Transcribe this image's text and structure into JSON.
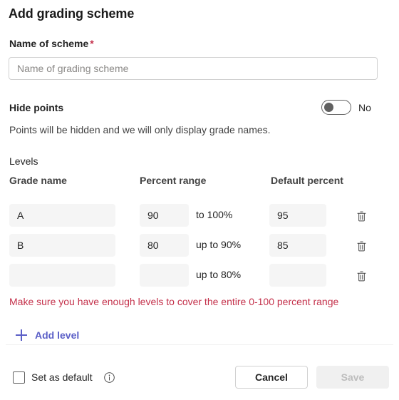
{
  "page_title": "Add grading scheme",
  "name_field": {
    "label": "Name of scheme",
    "required_marker": "*",
    "value": "",
    "placeholder": "Name of grading scheme"
  },
  "hide_points": {
    "label": "Hide points",
    "state": "No",
    "description": "Points will be hidden and we will only display grade names."
  },
  "levels": {
    "section_label": "Levels",
    "columns": {
      "grade_name": "Grade name",
      "percent_range": "Percent range",
      "default_percent": "Default percent"
    },
    "rows": [
      {
        "grade_name": "A",
        "percent": "90",
        "range_text": "to 100%",
        "default_percent": "95",
        "delete_icon": "trash-icon"
      },
      {
        "grade_name": "B",
        "percent": "80",
        "range_text": "up to 90%",
        "default_percent": "85",
        "delete_icon": "trash-icon"
      },
      {
        "grade_name": "",
        "percent": "",
        "range_text": "up to 80%",
        "default_percent": "",
        "delete_icon": "trash-icon"
      }
    ],
    "error_message": "Make sure you have enough levels to cover the entire 0-100 percent range",
    "add_level_label": "Add level",
    "add_level_icon": "plus-icon"
  },
  "footer": {
    "set_as_default_label": "Set as default",
    "set_as_default_checked": false,
    "info_icon": "info-icon",
    "cancel_label": "Cancel",
    "save_label": "Save",
    "save_disabled": true
  },
  "colors": {
    "accent": "#5b5fc7",
    "error": "#c4314b",
    "text": "#242424",
    "field_bg": "#f5f5f5"
  }
}
